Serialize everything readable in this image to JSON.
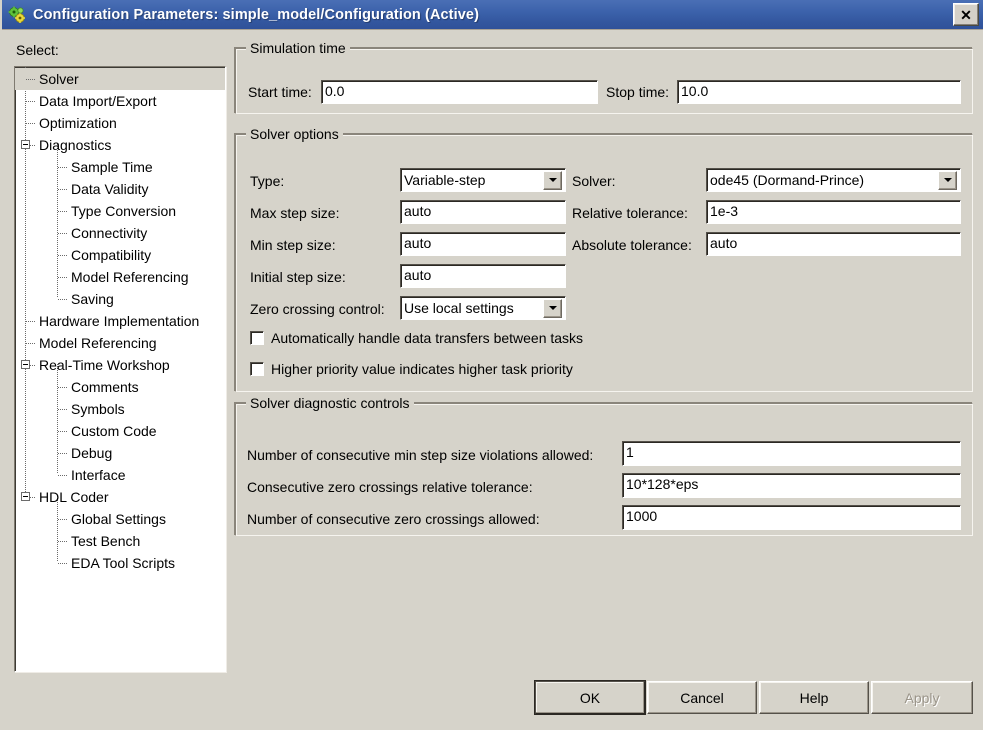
{
  "window": {
    "title": "Configuration Parameters: simple_model/Configuration (Active)",
    "icon": "simulink-gears-icon",
    "close_label": "✕",
    "titlebar_color": "#3c62ab",
    "background_color": "#d6d3ca"
  },
  "sidebar": {
    "header": "Select:",
    "selected": "Solver",
    "items": [
      {
        "label": "Solver",
        "level": 1,
        "expander": false,
        "selected": true
      },
      {
        "label": "Data Import/Export",
        "level": 1,
        "expander": false,
        "selected": false
      },
      {
        "label": "Optimization",
        "level": 1,
        "expander": false,
        "selected": false
      },
      {
        "label": "Diagnostics",
        "level": 1,
        "expander": true,
        "selected": false
      },
      {
        "label": "Sample Time",
        "level": 2,
        "expander": false,
        "selected": false
      },
      {
        "label": "Data Validity",
        "level": 2,
        "expander": false,
        "selected": false
      },
      {
        "label": "Type Conversion",
        "level": 2,
        "expander": false,
        "selected": false
      },
      {
        "label": "Connectivity",
        "level": 2,
        "expander": false,
        "selected": false
      },
      {
        "label": "Compatibility",
        "level": 2,
        "expander": false,
        "selected": false
      },
      {
        "label": "Model Referencing",
        "level": 2,
        "expander": false,
        "selected": false
      },
      {
        "label": "Saving",
        "level": 2,
        "expander": false,
        "selected": false,
        "last_child": true
      },
      {
        "label": "Hardware Implementation",
        "level": 1,
        "expander": false,
        "selected": false
      },
      {
        "label": "Model Referencing",
        "level": 1,
        "expander": false,
        "selected": false
      },
      {
        "label": "Real-Time Workshop",
        "level": 1,
        "expander": true,
        "selected": false
      },
      {
        "label": "Comments",
        "level": 2,
        "expander": false,
        "selected": false
      },
      {
        "label": "Symbols",
        "level": 2,
        "expander": false,
        "selected": false
      },
      {
        "label": "Custom Code",
        "level": 2,
        "expander": false,
        "selected": false
      },
      {
        "label": "Debug",
        "level": 2,
        "expander": false,
        "selected": false
      },
      {
        "label": "Interface",
        "level": 2,
        "expander": false,
        "selected": false,
        "last_child": true
      },
      {
        "label": "HDL Coder",
        "level": 1,
        "expander": true,
        "selected": false
      },
      {
        "label": "Global Settings",
        "level": 2,
        "expander": false,
        "selected": false
      },
      {
        "label": "Test Bench",
        "level": 2,
        "expander": false,
        "selected": false
      },
      {
        "label": "EDA Tool Scripts",
        "level": 2,
        "expander": false,
        "selected": false,
        "last_child": true
      }
    ]
  },
  "simulation_time": {
    "group_title": "Simulation time",
    "start_label": "Start time:",
    "start_value": "0.0",
    "stop_label": "Stop time:",
    "stop_value": "10.0"
  },
  "solver_options": {
    "group_title": "Solver options",
    "type_label": "Type:",
    "type_value": "Variable-step",
    "solver_label": "Solver:",
    "solver_value": "ode45 (Dormand-Prince)",
    "max_step_label": "Max step size:",
    "max_step_value": "auto",
    "rel_tol_label": "Relative tolerance:",
    "rel_tol_value": "1e-3",
    "min_step_label": "Min step size:",
    "min_step_value": "auto",
    "abs_tol_label": "Absolute tolerance:",
    "abs_tol_value": "auto",
    "initial_step_label": "Initial step size:",
    "initial_step_value": "auto",
    "zero_cross_label": "Zero crossing control:",
    "zero_cross_value": "Use local settings",
    "checkbox_auto_transfers": "Automatically handle data transfers between tasks",
    "checkbox_auto_transfers_checked": false,
    "checkbox_priority": "Higher priority value indicates higher task priority",
    "checkbox_priority_checked": false
  },
  "solver_diagnostics": {
    "group_title": "Solver diagnostic controls",
    "min_step_violations_label": "Number of consecutive min step size violations allowed:",
    "min_step_violations_value": "1",
    "zero_cross_tol_label": "Consecutive zero crossings relative tolerance:",
    "zero_cross_tol_value": "10*128*eps",
    "zero_cross_count_label": "Number of consecutive zero crossings allowed:",
    "zero_cross_count_value": "1000"
  },
  "buttons": {
    "ok": "OK",
    "cancel": "Cancel",
    "help": "Help",
    "apply": "Apply",
    "apply_disabled": true,
    "ok_is_default": true
  }
}
